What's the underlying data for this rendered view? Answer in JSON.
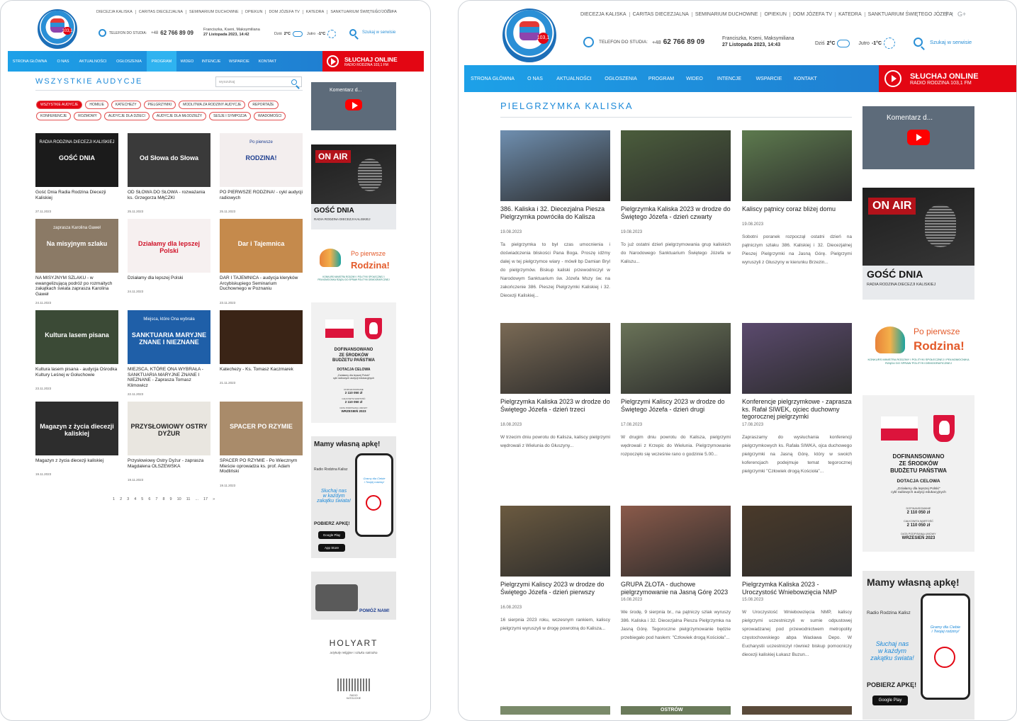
{
  "site": {
    "top_links": [
      "DIECEZJA KALISKA",
      "CARITAS DIECEZJALNA",
      "SEMINARIUM DUCHOWNE",
      "OPIEKUN",
      "DOM JÓZEFA TV",
      "KATEDRA",
      "SANKTUARIUM ŚWIĘTEGO JÓZEFA"
    ],
    "social": [
      "f",
      "t",
      "G+"
    ],
    "phone_label": "TELEFON DO STUDIA:",
    "phone_prefix": "+48",
    "phone_number": "62 766 89 09",
    "names": "Franciszka, Kseni, Maksymiliana",
    "weather_today_label": "Dziś",
    "weather_today": "2°C",
    "weather_tomorrow_label": "Jutro",
    "weather_tomorrow": "-1°C",
    "search_label": "Szukaj w serwisie",
    "logo_badge": "103,1",
    "nav": [
      "STRONA GŁÓWNA",
      "O NAS",
      "AKTUALNOŚCI",
      "OGŁOSZENIA",
      "PROGRAM",
      "WIDEO",
      "INTENCJE",
      "WSPARCIE",
      "KONTAKT"
    ],
    "listen_title": "SŁUCHAJ ONLINE",
    "listen_sub": "RADIO RODZINA 103,1 FM"
  },
  "left": {
    "date": "27 Listopada 2023, 14:42",
    "active_nav": "PROGRAM",
    "title": "WSZYSTKIE AUDYCJE",
    "search_placeholder": "wyszukaj",
    "tags": [
      "WSZYSTKIE AUDYCJE",
      "HOMILIE",
      "KATECHEZY",
      "PIELGRZYMKI",
      "MODLITWA ZA RODZINY AUDYCJE",
      "REPORTAŻE",
      "KONFERENCJE",
      "ROZMOWY",
      "AUDYCJE DLA DZIECI",
      "AUDYCJE DLA MŁODZIEŻY",
      "SESJE I SYMPOZJA",
      "WIADOMOŚCI"
    ],
    "active_tag": "WSZYSTKIE AUDYCJE",
    "cards": [
      {
        "title": "Gość Dnia Radia Rodzina Diecezji Kaliskiej",
        "date": "27.11.2023",
        "thumb": "GOŚĆ DNIA",
        "sub": "RADIA RODZINA DIECEZJI KALISKIEJ",
        "bg": "#1b1b1b",
        "fg": "#ffffff"
      },
      {
        "title": "OD SŁOWA DO SŁOWA - rozważania ks. Grzegorza MĄCZKI",
        "date": "25.11.2023",
        "thumb": "Od Słowa do Słowa",
        "sub": "",
        "bg": "#3a3a3a",
        "fg": "#ffffff"
      },
      {
        "title": "PO PIERWSZE RODZINA! - cykl audycji radiowych",
        "date": "25.11.2023",
        "thumb": "RODZINA!",
        "sub": "Po pierwsze",
        "bg": "#f3eeee",
        "fg": "#1d3d8f"
      },
      {
        "title": "NA MISYJNYM SZLAKU - w ewangelizującą podróż po rozmaitych zakątkach świata zaprasza Karolina Gaweł",
        "date": "24.11.2023",
        "thumb": "Na misyjnym szlaku",
        "sub": "zaprasza Karolina Gaweł",
        "bg": "#8b7a66",
        "fg": "#ffffff"
      },
      {
        "title": "Działamy dla lepszej Polski",
        "date": "24.11.2023",
        "thumb": "Działamy dla lepszej Polski",
        "sub": "",
        "bg": "#f6f0f0",
        "fg": "#d0142a"
      },
      {
        "title": "DAR I TAJEMNICA - audycja kleryków Arcybiskupiego Seminarium Duchownego w Poznaniu",
        "date": "23.11.2023",
        "thumb": "Dar i Tajemnica",
        "sub": "",
        "bg": "#c58a4c",
        "fg": "#ffffff"
      },
      {
        "title": "Kultura lasem pisana - audycja Ośrodka Kultury Leśnej w Gołuchowie",
        "date": "23.11.2023",
        "thumb": "Kultura lasem pisana",
        "sub": "",
        "bg": "#3b4a36",
        "fg": "#ffffff"
      },
      {
        "title": "MIEJSCA, KTÓRE ONA WYBRAŁA - SANKTUARIA MARYJNE ZNANE I NIEZNANE - Zaprasza Tomasz Klimowicz",
        "date": "22.11.2023",
        "thumb": "SANKTUARIA MARYJNE ZNANE I NIEZNANE",
        "sub": "Miejsca, które Ona wybrała",
        "bg": "#1f5fa8",
        "fg": "#ffffff"
      },
      {
        "title": "Katechezy - Ks. Tomasz Kaczmarek",
        "date": "21.11.2023",
        "thumb": "",
        "sub": "",
        "bg": "#3a2416",
        "fg": "#ffffff"
      },
      {
        "title": "Magazyn z życia diecezji kaliskiej",
        "date": "19.11.2023",
        "thumb": "Magazyn z życia diecezji kaliskiej",
        "sub": "",
        "bg": "#2d2d2d",
        "fg": "#ffffff"
      },
      {
        "title": "Przysłowiowy Ostry Dyżur - zaprasza Magdalena OLSZEWSKA",
        "date": "19.11.2023",
        "thumb": "PRZYSŁOWIOWY OSTRY DYŻUR",
        "sub": "",
        "bg": "#e9e6e0",
        "fg": "#222222"
      },
      {
        "title": "SPACER PO RZYMIE - Po Wiecznym Mieście oprowadza ks. prof. Adam Modliński",
        "date": "19.11.2023",
        "thumb": "SPACER PO RZYMIE",
        "sub": "",
        "bg": "#a98b6a",
        "fg": "#ffffff"
      }
    ],
    "pager": [
      "1",
      "2",
      "3",
      "4",
      "5",
      "6",
      "7",
      "8",
      "9",
      "10",
      "11",
      "...",
      "17",
      "»"
    ]
  },
  "right": {
    "date": "27 Listopada 2023, 14:43",
    "title": "PIELGRZYMKA KALISKA",
    "cards": [
      {
        "title": "386. Kaliska i 32. Diecezjalna Piesza Pielgrzymka powróciła do Kalisza",
        "date": "19.08.2023",
        "excerpt": "Ta pielgrzymka to był czas umocnienia i doświadczenia bliskości Pana Boga. Proszę idźmy dalej w tej pielgrzymce wiary - mówił bp Damian Bryl do pielgrzymów. Biskup kaliski przewodniczył w Narodowym Sanktuarium św. Józefa Mszy św. na zakończenie 386. Pieszej Pielgrzymki Kaliskiej i 32. Diecezji Kaliskiej...",
        "bg": "#6f8fb0"
      },
      {
        "title": "Pielgrzymka Kaliska 2023 w drodze do Świętego Józefa - dzień czwarty",
        "date": "19.08.2023",
        "excerpt": "To już ostatni dzień pielgrzymowania grup kaliskich do Narodowego Sanktuarium Świętego Józefa w Kaliszu...",
        "bg": "#4b5d3c"
      },
      {
        "title": "Kaliscy pątnicy coraz bliżej domu",
        "date": "19.08.2023",
        "excerpt": "Sobotni poranek rozpoczął ostatni dzień na pątniczym szlaku 386. Kaliskiej i 32. Diecezjalnej Pieszej Pielgrzymki na Jasną Górę. Pielgrzymi wyruszyli z Głuszyny w kierunku Brzezin...",
        "bg": "#5d7a4e"
      },
      {
        "title": "Pielgrzymka Kaliska 2023 w drodze do Świętego Józefa - dzień trzeci",
        "date": "18.08.2023",
        "excerpt": "W trzecim dniu powrotu do Kalisza, kaliscy pielgrzymi wędrowali z Wielunia do Głuszyny...",
        "bg": "#7a6a55"
      },
      {
        "title": "Pielgrzymi Kaliscy 2023 w drodze do Świętego Józefa - dzień drugi",
        "date": "17.08.2023",
        "excerpt": "W drugim dniu powrotu do Kalisza, pielgrzymi wędrowali z Krzepic do Wielunia. Pielgrzymowanie rozpoczęło się wcześnie rano o godzinie 5.00...",
        "bg": "#6a7358"
      },
      {
        "title": "Konferencje pielgrzymkowe - zaprasza ks. Rafał SIWEK, ojciec duchowny tegorocznej pielgrzymki",
        "date": "17.08.2023",
        "excerpt": "Zapraszamy do wysłuchania konferencji pielgrzymkowych ks. Rafała SIWKA, ojca duchowego pielgrzymki na Jasną Górę, który w swoich koferencjach podejmuje temat tegorocznej pielgrzymki \"Człowiek drogą Kościoła\"...",
        "bg": "#5b4a6e"
      },
      {
        "title": "Pielgrzymi Kaliscy 2023 w drodze do Świętego Józefa - dzień pierwszy",
        "date": "16.08.2023",
        "excerpt": "16 sierpnia 2023 roku, wczesnym rankiem, kaliscy pielgrzymi wyruszyli w drogę powrotną do Kalisza...",
        "bg": "#6b5a40"
      },
      {
        "title": "GRUPA ZŁOTA - duchowe pielgrzymowanie na Jasną Górę 2023",
        "date": "16.08.2023",
        "excerpt": "We środę, 9 sierpnia br., na pątniczy szlak wyruszy 386. Kaliska i 32. Diecezjalna Piesza Pielgrzymka na Jasną Górę. Tegoroczne pielgrzymowanie będzie przebiegało pod hasłem: \"Człowiek drogą Kościoła\"...",
        "bg": "#8a5a4a"
      },
      {
        "title": "Pielgrzymka Kaliska 2023 - Uroczystość Wniebowzięcia NMP",
        "date": "15.08.2023",
        "excerpt": "W Uroczystość Wniebowzięcia NMP, kaliscy pielgrzymi uczestniczyli w sumie odpustowej sprowadzanej pod przewodnictwem metropolity częstochowskiego abpa Wacława Depo. W Eucharystii uczestniczył również biskup pomocniczy diecezji kaliskiej Łukasz Buzun...",
        "bg": "#4a3a2a"
      }
    ],
    "more_thumb_label": "OSTRÓW"
  },
  "sidebar": {
    "yt_title": "Komentarz d...",
    "gosc_title": "GOŚĆ DNIA",
    "gosc_sub": "RADIA RODZINA DIECEZJI KALISKIEJ",
    "on_air": "ON AIR",
    "rodzina_small": "Po pierwsze",
    "rodzina_big": "Rodzina!",
    "rodzina_note": "KONKURS MINISTRA RODZINY I POLITYKI SPOŁECZNEJ I PEŁNOMOCNIKA RZĄDU DO SPRAW POLITYKI DEMOGRAFICZNEJ",
    "dof_title": "DOFINANSOWANO\nZE ŚRODKÓW\nBUDŻETU PAŃSTWA",
    "dof_dotacja": "DOTACJA CELOWA",
    "dof_project": "„Działamy dla lepszej Polski\"\ncykl radiowych audycji edukacyjnych",
    "dof_amount_label": "DOFINANSOWANIE",
    "dof_amount": "2 110 050 zł",
    "dof_total_label": "CAŁKOWITA WARTOŚĆ",
    "dof_total": "2 110 050 zł",
    "dof_date_label": "DATA PODPISANIA UMOWY",
    "dof_date": "WRZESIEŃ 2023",
    "app_title": "Mamy własną apkę!",
    "app_radio": "Radio Rodzina Kalisz",
    "app_slogan": "Słuchaj nas\nw każdym\nzakątku świata!",
    "app_phone_text": "Gramy dla Ciebie\ni Twojej rodziny!",
    "app_get": "POBIERZ APKĘ!",
    "app_google": "Google Play",
    "app_apple": "App Store",
    "help": "POMÓŻ NAM!",
    "holyart": "HOLYART",
    "holyart_sub": "artykuły religijne i sztuka sakralna",
    "radio_kat": "RADIO\nKATOLICKIE"
  },
  "colors": {
    "accent": "#1d8ad9",
    "nav": "#1f8fdd",
    "listen": "#e30613"
  }
}
